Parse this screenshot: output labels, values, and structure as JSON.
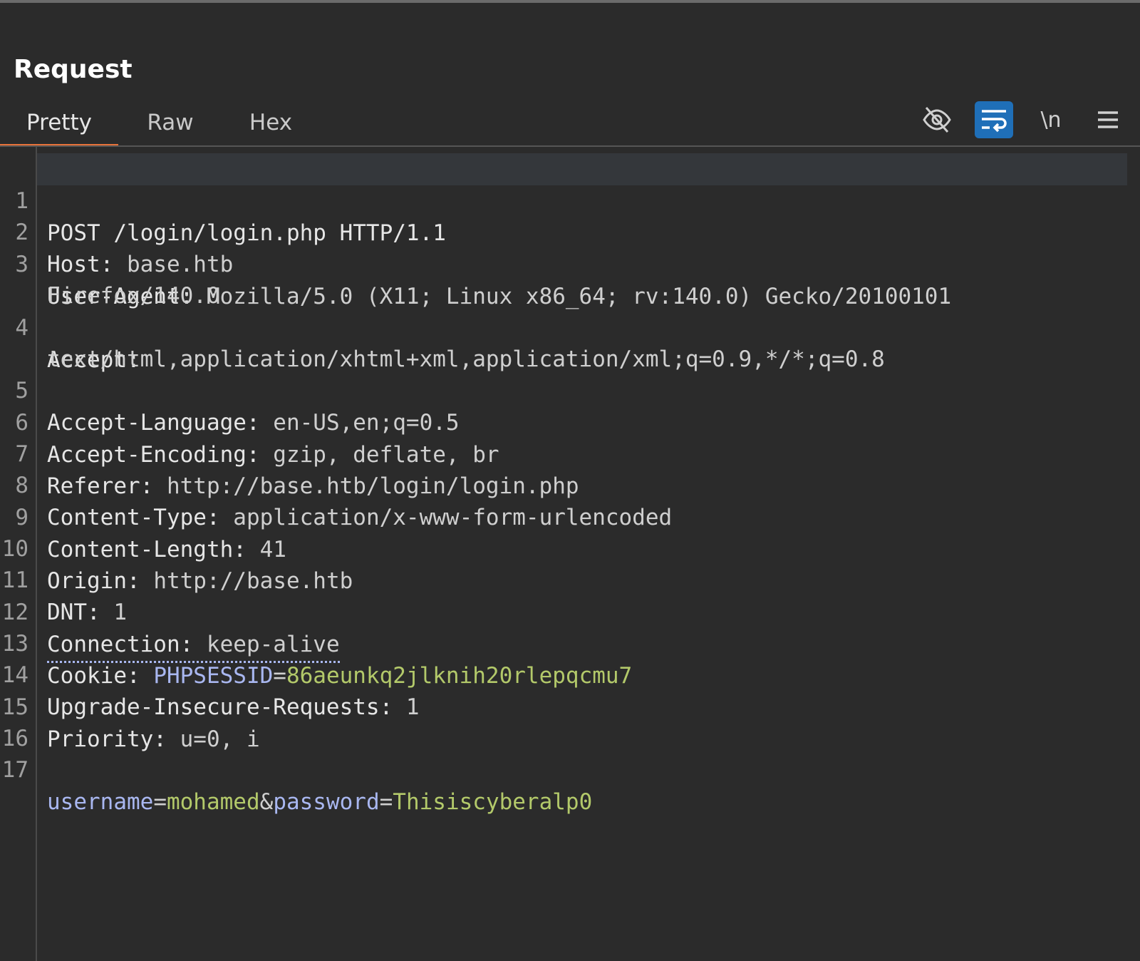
{
  "panel": {
    "title": "Request"
  },
  "tabs": [
    {
      "label": "Pretty",
      "active": true
    },
    {
      "label": "Raw",
      "active": false
    },
    {
      "label": "Hex",
      "active": false
    }
  ],
  "toolbar": {
    "hide_icon": "eye-off-icon",
    "wrap_icon": "word-wrap-icon",
    "newline_label": "\\n",
    "menu_icon": "hamburger-menu-icon"
  },
  "colors": {
    "accent_tab": "#e8733a",
    "toggle_on": "#1f6fb8",
    "param_name": "#a9b7f0",
    "param_value": "#b3c96a"
  },
  "request": {
    "lines": [
      {
        "n": "1",
        "text": "POST /login/login.php HTTP/1.1"
      },
      {
        "n": "2",
        "name": "Host:",
        "value": " base.htb"
      },
      {
        "n": "3",
        "name": "User-Agent:",
        "value": " Mozilla/5.0 (X11; Linux x86_64; rv:140.0) Gecko/20100101",
        "cont": "Firefox/140.0"
      },
      {
        "n": "4",
        "name": "Accept:",
        "value": "",
        "cont": "text/html,application/xhtml+xml,application/xml;q=0.9,*/*;q=0.8"
      },
      {
        "n": "5",
        "name": "Accept-Language:",
        "value": " en-US,en;q=0.5"
      },
      {
        "n": "6",
        "name": "Accept-Encoding:",
        "value": " gzip, deflate, br"
      },
      {
        "n": "7",
        "name": "Referer:",
        "value": " http://base.htb/login/login.php"
      },
      {
        "n": "8",
        "name": "Content-Type:",
        "value": " application/x-www-form-urlencoded"
      },
      {
        "n": "9",
        "name": "Content-Length:",
        "value": " 41"
      },
      {
        "n": "10",
        "name": "Origin:",
        "value": " http://base.htb"
      },
      {
        "n": "11",
        "name": "DNT:",
        "value": " 1"
      },
      {
        "n": "12",
        "name": "Connection:",
        "value": " keep-alive"
      },
      {
        "n": "13",
        "name": "Cookie:",
        "cookie_key": " PHPSESSID",
        "cookie_eq": "=",
        "cookie_val": "86aeunkq2jlknih20rlepqcmu7"
      },
      {
        "n": "14",
        "name": "Upgrade-Insecure-Requests:",
        "value": " 1"
      },
      {
        "n": "15",
        "name": "Priority:",
        "value": " u=0, i"
      },
      {
        "n": "16"
      },
      {
        "n": "17",
        "p1_key": "username",
        "eq1": "=",
        "p1_val": "mohamed",
        "amp": "&",
        "p2_key": "password",
        "eq2": "=",
        "p2_val": "Thisiscyberalp0"
      }
    ]
  }
}
